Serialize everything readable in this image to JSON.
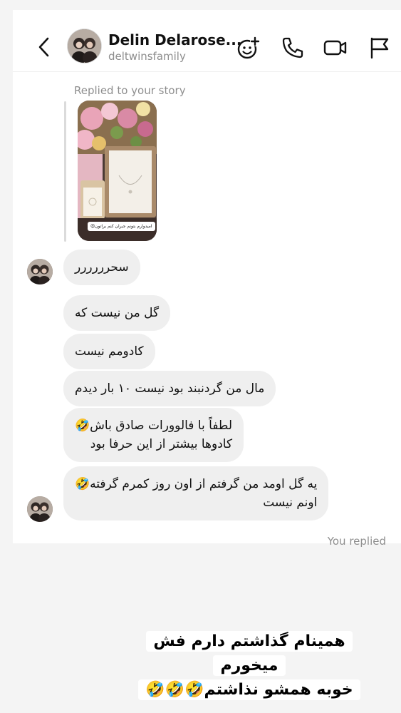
{
  "header": {
    "name": "Delin Delarose...",
    "handle": "deltwinsfamily",
    "icons": [
      "chevron-left-icon",
      "add-effect-icon",
      "phone-icon",
      "video-icon",
      "flag-icon"
    ]
  },
  "story_reply": {
    "label": "Replied to your story",
    "story_caption": "امیدوارم بتونم جبران کنم براتون😍"
  },
  "messages": [
    {
      "lines": [
        "سحرررررر"
      ]
    },
    {
      "lines": [
        "گل من نیست که"
      ]
    },
    {
      "lines": [
        "کادومم نیست"
      ]
    },
    {
      "lines": [
        "مال من گردنبند بود نیست ۱۰ بار دیدم"
      ]
    },
    {
      "lines": [
        "لطفاً با فالوورات صادق باش🤣",
        "کادوها بیشتر از این حرفا بود"
      ]
    },
    {
      "lines": [
        "یه گل اومد من گرفتم از اون روز کمرم گرفته🤣",
        "اونم نیست"
      ]
    }
  ],
  "you_replied_label": "You replied",
  "overlay": {
    "line1": "همینام گذاشتم دارم فش میخورم",
    "line2": "خوبه همشو نذاشتم🤣🤣🤣"
  },
  "colors": {
    "bubble_bg": "#efefef",
    "meta_text": "#8e8e8e",
    "page_bg": "#f4f4f4"
  }
}
